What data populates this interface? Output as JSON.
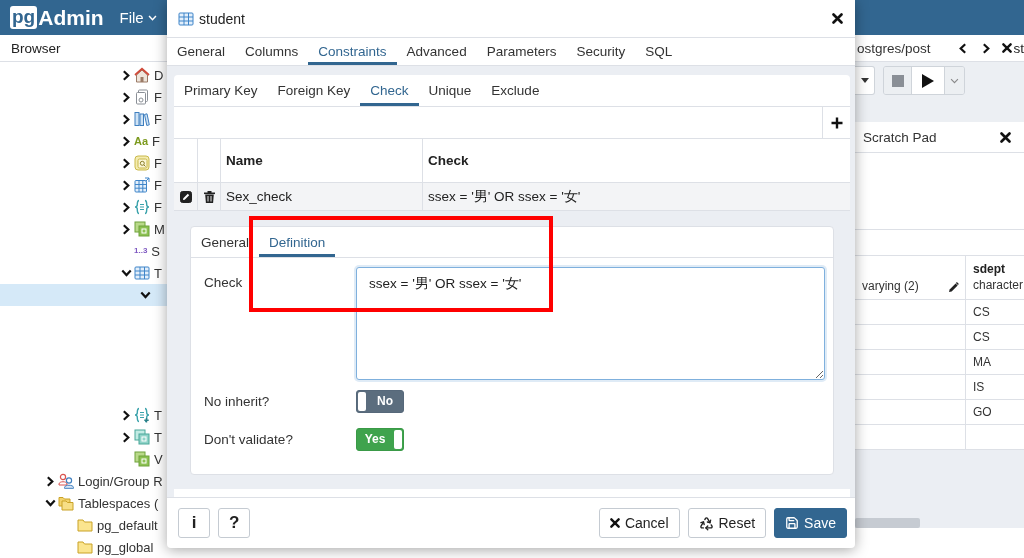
{
  "app": {
    "logo": {
      "mark": "pg",
      "name": "Admin"
    },
    "menu": [
      {
        "label": "File"
      }
    ]
  },
  "browser": {
    "title": "Browser",
    "schema_objects": [
      {
        "kind": "domain",
        "label": "D",
        "expandable": true,
        "expanded": false,
        "selected": false
      },
      {
        "kind": "ftsconfig",
        "label": "F",
        "expandable": true,
        "expanded": false,
        "selected": false
      },
      {
        "kind": "ftsdict",
        "label": "F",
        "expandable": true,
        "expanded": false,
        "selected": false
      },
      {
        "kind": "ftsparser",
        "icon_text": "Aa",
        "label": "F",
        "expandable": true,
        "expanded": false,
        "selected": false
      },
      {
        "kind": "ftstemplate",
        "label": "F",
        "expandable": true,
        "expanded": false,
        "selected": false
      },
      {
        "kind": "foreigntable",
        "label": "F",
        "expandable": true,
        "expanded": false,
        "selected": false
      },
      {
        "kind": "function",
        "label": "F",
        "expandable": true,
        "expanded": false,
        "selected": false
      },
      {
        "kind": "matview",
        "label": "M",
        "expandable": true,
        "expanded": false,
        "selected": false
      },
      {
        "kind": "sequence",
        "icon_text": "1..3",
        "label": "S",
        "expandable": false,
        "selected": false
      },
      {
        "kind": "table",
        "label": "T",
        "expandable": true,
        "expanded": true,
        "selected": false,
        "children": [
          {
            "expandable": true,
            "expanded": true,
            "selected": true
          }
        ]
      },
      {
        "kind": "trigger",
        "label": "T",
        "expandable": true,
        "expanded": false,
        "selected": false
      },
      {
        "kind": "type",
        "label": "T",
        "expandable": true,
        "expanded": false,
        "selected": false
      },
      {
        "kind": "view",
        "label": "V",
        "expandable": false,
        "selected": false
      }
    ],
    "server_objects": [
      {
        "kind": "role",
        "label": "Login/Group R",
        "expandable": true,
        "expanded": false,
        "selected": false
      },
      {
        "kind": "tablespace",
        "label": "Tablespaces (",
        "expandable": true,
        "expanded": true,
        "selected": false,
        "children": [
          {
            "kind": "folder",
            "label": "pg_default",
            "expandable": false,
            "selected": false
          },
          {
            "kind": "folder",
            "label": "pg_global",
            "expandable": false,
            "selected": false
          }
        ]
      }
    ]
  },
  "query_tool": {
    "breadcrumb": "ostgres/post",
    "tab_title": "st",
    "scratch_pad": {
      "title": "Scratch Pad"
    },
    "result_grid": {
      "columns": [
        {
          "type": "varying (2)",
          "editable": true
        },
        {
          "name": "sdept",
          "type": "character"
        }
      ],
      "rows": [
        "CS",
        "CS",
        "MA",
        "IS",
        "GO"
      ]
    }
  },
  "dialog": {
    "title": "student",
    "tabs": [
      {
        "label": "General",
        "selected": false
      },
      {
        "label": "Columns",
        "selected": false
      },
      {
        "label": "Constraints",
        "selected": true
      },
      {
        "label": "Advanced",
        "selected": false
      },
      {
        "label": "Parameters",
        "selected": false
      },
      {
        "label": "Security",
        "selected": false
      },
      {
        "label": "SQL",
        "selected": false
      }
    ],
    "constraint_tabs": [
      {
        "label": "Primary Key",
        "selected": false
      },
      {
        "label": "Foreign Key",
        "selected": false
      },
      {
        "label": "Check",
        "selected": true
      },
      {
        "label": "Unique",
        "selected": false
      },
      {
        "label": "Exclude",
        "selected": false
      }
    ],
    "check_table": {
      "columns": [
        {
          "label": "Name"
        },
        {
          "label": "Check"
        }
      ],
      "rows": [
        {
          "name": "Sex_check",
          "check": "ssex = '男' OR ssex = '女'",
          "expanded": true
        }
      ]
    },
    "editor": {
      "tabs": [
        {
          "label": "General",
          "selected": false
        },
        {
          "label": "Definition",
          "selected": true
        }
      ],
      "fields": [
        {
          "kind": "textarea",
          "label": "Check",
          "value": "ssex = '男' OR ssex = '女'"
        },
        {
          "kind": "switch",
          "label": "No inherit?",
          "on": false,
          "text": "No"
        },
        {
          "kind": "switch",
          "label": "Don't validate?",
          "on": true,
          "text": "Yes"
        }
      ]
    },
    "footer": {
      "help_buttons": [
        {
          "label": "i"
        },
        {
          "label": "?"
        }
      ],
      "actions": [
        {
          "kind": "cancel",
          "label": "Cancel"
        },
        {
          "kind": "reset",
          "label": "Reset"
        },
        {
          "kind": "save",
          "label": "Save"
        }
      ]
    }
  },
  "annotation": {
    "highlight_frame": true
  }
}
